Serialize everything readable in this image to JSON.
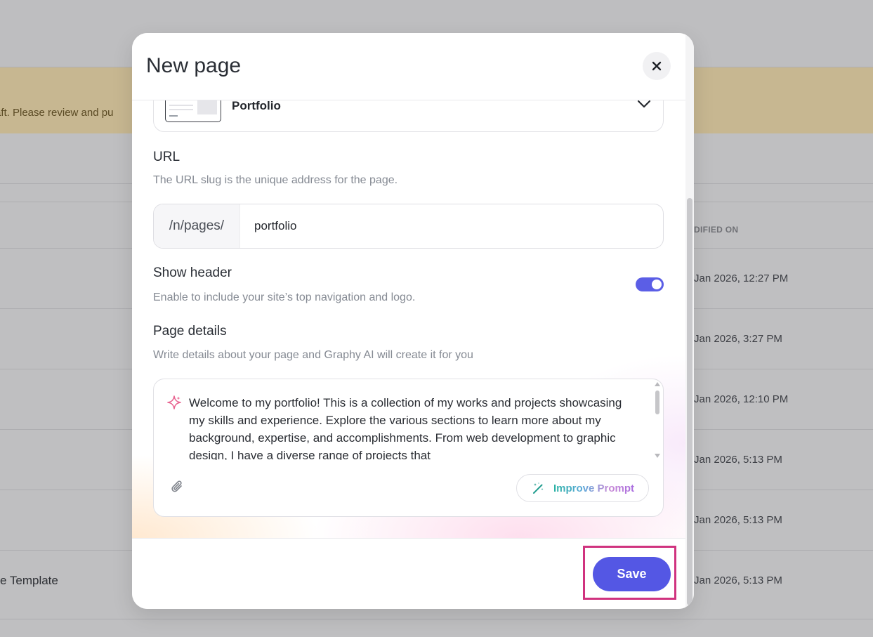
{
  "background": {
    "banner_text": "raft. Please review and pu",
    "column_header": "DIFIED ON",
    "dates": [
      "Jan 2026, 12:27 PM",
      "Jan 2026, 3:27 PM",
      "Jan 2026, 12:10 PM",
      "Jan 2026, 5:13 PM",
      "Jan 2026, 5:13 PM",
      "Jan 2026, 5:13 PM"
    ],
    "last_row_title": "e Template"
  },
  "modal": {
    "title": "New page",
    "close_icon": "close-icon",
    "template": {
      "label": "Portfolio",
      "chevron_icon": "chevron-down-icon"
    },
    "url": {
      "label": "URL",
      "help": "The URL slug is the unique address for the page.",
      "prefix": "/n/pages/",
      "value": "portfolio"
    },
    "show_header": {
      "label": "Show header",
      "help": "Enable to include your site’s top navigation and logo.",
      "enabled": true
    },
    "page_details": {
      "label": "Page details",
      "help": "Write details about your page and Graphy AI will create it for you",
      "text": "Welcome to my portfolio! This is a collection of my works and projects showcasing my skills and experience. Explore the various sections to learn more about my background, expertise, and accomplishments. From web development to graphic design, I have a diverse range of projects that",
      "sparkle_icon": "sparkle-icon",
      "attach_icon": "paperclip-icon",
      "improve_label": "Improve Prompt",
      "improve_icon": "magic-wand-icon"
    },
    "save_label": "Save",
    "accent_color": "#5457e4",
    "highlight_color": "#d0337f"
  }
}
